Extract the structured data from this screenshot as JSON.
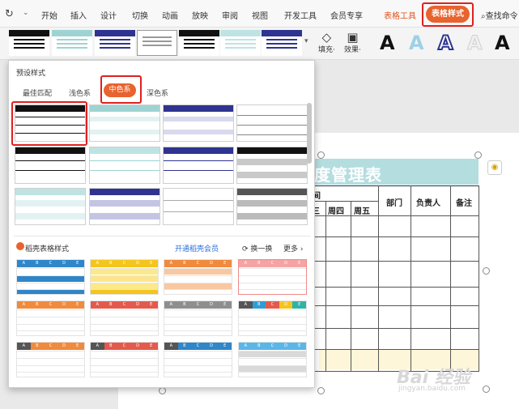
{
  "menubar": {
    "undo_glyph": "↻",
    "tabs": [
      "开始",
      "插入",
      "设计",
      "切换",
      "动画",
      "放映",
      "审阅",
      "视图",
      "开发工具",
      "会员专享",
      "表格工具"
    ],
    "active_tab": "表格样式",
    "search_label": "查找命令"
  },
  "ribbon": {
    "tools": [
      {
        "icon": "fill-icon",
        "label": "填充·"
      },
      {
        "icon": "effect-icon",
        "label": "效果·"
      }
    ],
    "text_styles": [
      "A",
      "A",
      "A",
      "A",
      "A"
    ]
  },
  "panel": {
    "heading": "预设样式",
    "subtabs": [
      "最佳匹配",
      "浅色系",
      "中色系",
      "深色系"
    ],
    "active_subtab": "中色系",
    "docer_label": "稻壳表格样式",
    "vip_link": "开通稻壳会员",
    "swap_label": "换一换",
    "more_label": "更多",
    "docer_letters": [
      "A",
      "B",
      "C",
      "D",
      "E"
    ]
  },
  "document": {
    "title": "度管理表",
    "header_fragment": "间",
    "col_fragment": "三",
    "headers": [
      "周四",
      "周五",
      "部门",
      "负责人",
      "备注"
    ]
  },
  "watermark": "Bai 经验",
  "watermark_url": "jingyan.baidu.com",
  "colors": {
    "accent": "#e8632e",
    "highlight_red": "#e02020",
    "title_fill": "#b4dde0",
    "navy": "#2f3490",
    "teal": "#9fd3d3"
  }
}
